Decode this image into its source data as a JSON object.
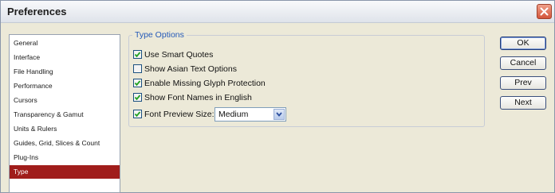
{
  "window": {
    "title": "Preferences"
  },
  "categories": [
    {
      "label": "General",
      "selected": false
    },
    {
      "label": "Interface",
      "selected": false
    },
    {
      "label": "File Handling",
      "selected": false
    },
    {
      "label": "Performance",
      "selected": false
    },
    {
      "label": "Cursors",
      "selected": false
    },
    {
      "label": "Transparency & Gamut",
      "selected": false
    },
    {
      "label": "Units & Rulers",
      "selected": false
    },
    {
      "label": "Guides, Grid, Slices & Count",
      "selected": false
    },
    {
      "label": "Plug-Ins",
      "selected": false
    },
    {
      "label": "Type",
      "selected": true
    }
  ],
  "type_options": {
    "legend": "Type Options",
    "options": [
      {
        "label": "Use Smart Quotes",
        "checked": true
      },
      {
        "label": "Show Asian Text Options",
        "checked": false
      },
      {
        "label": "Enable Missing Glyph Protection",
        "checked": true
      },
      {
        "label": "Show Font Names in English",
        "checked": true
      },
      {
        "label": "Font Preview Size:",
        "checked": true
      }
    ],
    "font_preview_size": "Medium"
  },
  "buttons": {
    "ok": "OK",
    "cancel": "Cancel",
    "prev": "Prev",
    "next": "Next"
  },
  "colors": {
    "selected_item": "#a01d1b",
    "legend_text": "#2459b8",
    "close_button": "#d3553b"
  },
  "icons": {
    "close": "close-icon",
    "checkmark": "checkmark-icon",
    "dropdown": "chevron-down-icon"
  }
}
